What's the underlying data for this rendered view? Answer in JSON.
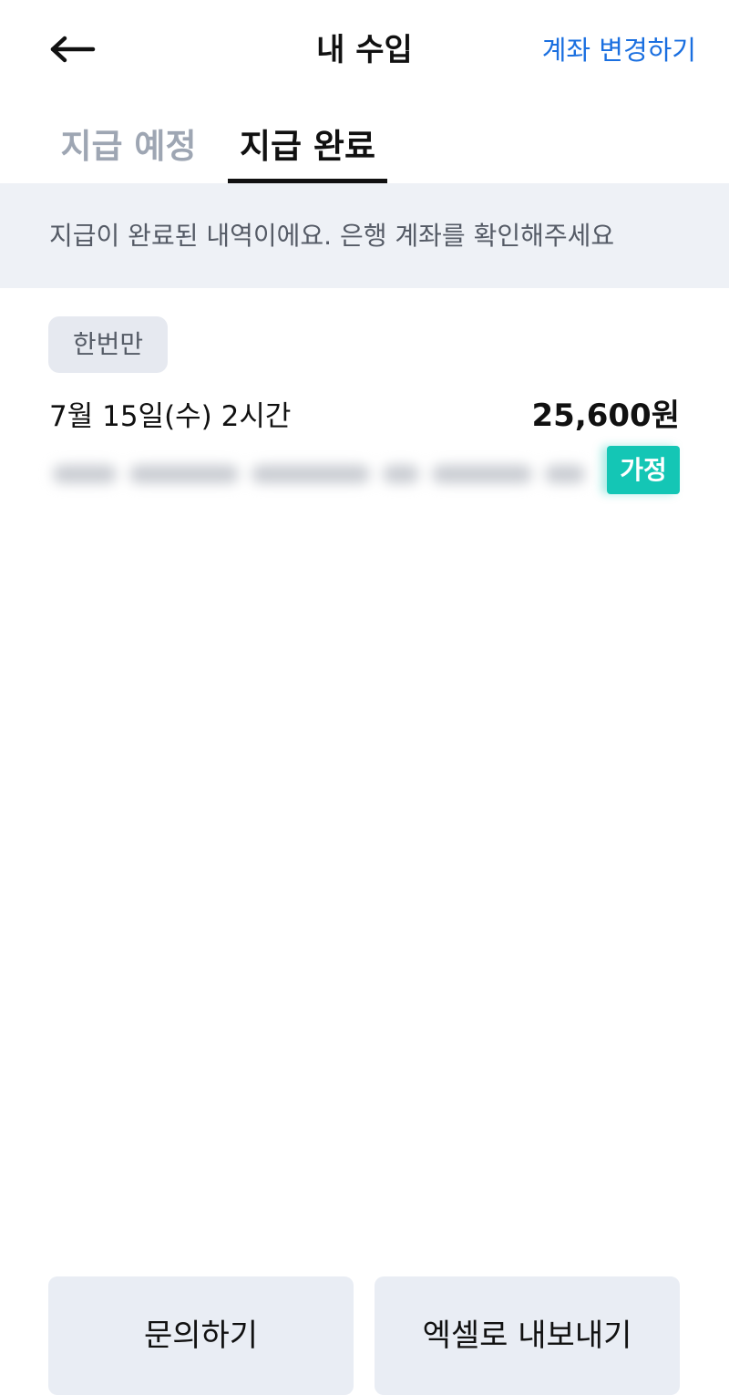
{
  "header": {
    "title": "내 수입",
    "change_account_label": "계좌 변경하기",
    "back_icon": "arrow-left-icon"
  },
  "tabs": [
    {
      "label": "지급 예정",
      "active": false
    },
    {
      "label": "지급 완료",
      "active": true
    }
  ],
  "notice": {
    "text": "지급이 완료된 내역이에요. 은행 계좌를 확인해주세요"
  },
  "entries": [
    {
      "type_chip": "한번만",
      "date": "7월 15일(수) 2시간",
      "amount": "25,600원",
      "category_badge": "가정"
    }
  ],
  "buttons": {
    "inquiry_label": "문의하기",
    "export_label": "엑셀로 내보내기"
  },
  "colors": {
    "accent_blue": "#1a6fe0",
    "badge_teal": "#14c6b5",
    "notice_bg": "#eef1f6",
    "inactive_tab": "#9ea6b3"
  }
}
